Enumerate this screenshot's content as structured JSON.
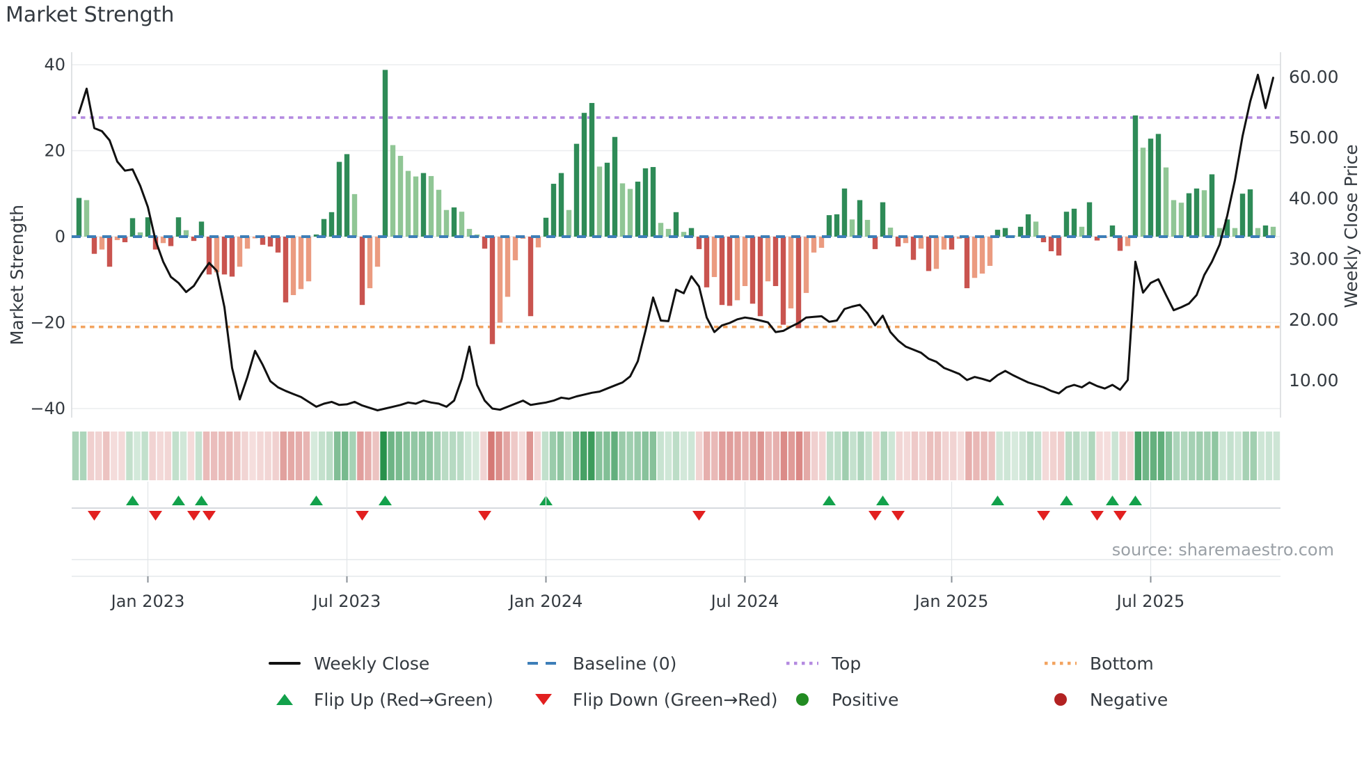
{
  "title": "Market Strength",
  "source": "source: sharemaestro.com",
  "chart_data": {
    "type": "combo-bar-line-heatmap",
    "title": "Market Strength",
    "left_axis": {
      "label": "Market Strength",
      "ticks": [
        "40",
        "20",
        "0",
        "−20",
        "−40"
      ],
      "tick_values": [
        40,
        20,
        0,
        -20,
        -40
      ],
      "range": [
        -44,
        44
      ],
      "grid": true
    },
    "right_axis": {
      "label": "Weekly Close Price",
      "ticks": [
        "60.00",
        "50.00",
        "40.00",
        "30.00",
        "20.00",
        "10.00"
      ],
      "tick_values": [
        60,
        50,
        40,
        30,
        20,
        10
      ]
    },
    "x_ticks": [
      {
        "index": 9,
        "label": "Jan 2023"
      },
      {
        "index": 35,
        "label": "Jul 2023"
      },
      {
        "index": 61,
        "label": "Jan 2024"
      },
      {
        "index": 87,
        "label": "Jul 2024"
      },
      {
        "index": 114,
        "label": "Jan 2025"
      },
      {
        "index": 140,
        "label": "Jul 2025"
      }
    ],
    "baseline_value": 0,
    "top_level_value": 27.7,
    "bottom_level_value": -21,
    "series": [
      {
        "name": "Market Strength (weekly bars)",
        "type": "bar",
        "values": [
          9,
          8.5,
          -4,
          -3,
          -7,
          -0.8,
          -1.3,
          4.3,
          1,
          4.5,
          -3,
          -1.5,
          -2.2,
          4.5,
          1.5,
          -1,
          3.5,
          -8.8,
          -8.3,
          -8.8,
          -9.3,
          -7,
          -2.8,
          -0.4,
          -1.9,
          -2.3,
          -3.7,
          -15.3,
          -13.6,
          -12.2,
          -10.4,
          0.5,
          4.1,
          5.7,
          17.4,
          19.2,
          9.9,
          -15.9,
          -12,
          -7,
          38.8,
          21.3,
          18.8,
          15.3,
          14,
          14.8,
          14.1,
          10.9,
          6.2,
          6.8,
          5.8,
          1.8,
          0.5,
          -2.8,
          -25,
          -20,
          -14,
          -5.5,
          -0.5,
          -18.5,
          -2.5,
          4.4,
          12.3,
          14.8,
          6.2,
          21.6,
          28.8,
          31.1,
          16.3,
          17.2,
          23.2,
          12.4,
          11.1,
          12.8,
          15.9,
          16.2,
          3.2,
          1.8,
          5.7,
          1.1,
          2,
          -2.9,
          -11.8,
          -9.4,
          -15.9,
          -16.1,
          -14.8,
          -11.5,
          -15.6,
          -18.5,
          -10.4,
          -11.5,
          -20.5,
          -16.7,
          -21.3,
          -13.1,
          -3.7,
          -2.6,
          5,
          5.2,
          11.2,
          4,
          8.5,
          3.9,
          -2.9,
          8,
          2.1,
          -2.3,
          -1.5,
          -5.4,
          -2.8,
          -8,
          -7.5,
          -3,
          -3,
          -0.5,
          -12,
          -9.6,
          -8.6,
          -6.8,
          1.6,
          2,
          0.3,
          2.3,
          5.2,
          3.5,
          -1.3,
          -3.4,
          -4.4,
          5.8,
          6.5,
          2.3,
          8,
          -0.9,
          -0.3,
          2.6,
          -3.3,
          -2.2,
          28.2,
          20.7,
          22.8,
          23.9,
          16.1,
          8.5,
          7.9,
          10.1,
          11.2,
          10.8,
          14.5,
          2,
          4,
          2,
          10,
          11,
          2,
          2.6,
          2.3
        ]
      },
      {
        "name": "Weekly Close",
        "type": "line",
        "values": [
          54,
          58,
          51.5,
          51,
          49.5,
          46,
          44.5,
          44.7,
          42,
          38.5,
          33,
          29.5,
          27,
          26,
          24.5,
          25.5,
          27.5,
          29.3,
          28,
          22,
          12,
          6.8,
          10.5,
          14.8,
          12.5,
          9.8,
          8.8,
          8.2,
          7.7,
          7.2,
          6.4,
          5.6,
          6.1,
          6.4,
          5.9,
          6,
          6.4,
          5.8,
          5.4,
          5,
          5.3,
          5.6,
          5.9,
          6.3,
          6.1,
          6.6,
          6.3,
          6.1,
          5.6,
          6.6,
          10.2,
          15.5,
          9.2,
          6.6,
          5.3,
          5.1,
          5.6,
          6.1,
          6.6,
          5.9,
          6.1,
          6.3,
          6.6,
          7.1,
          6.9,
          7.3,
          7.6,
          7.9,
          8.1,
          8.6,
          9.1,
          9.6,
          10.6,
          13.1,
          18.1,
          23.6,
          19.8,
          19.7,
          24.9,
          24.3,
          27.1,
          25.4,
          20.3,
          17.9,
          19,
          19.4,
          20,
          20.3,
          20.1,
          19.8,
          19.5,
          17.9,
          18.1,
          18.8,
          19.4,
          20.3,
          20.4,
          20.5,
          19.6,
          19.8,
          21.7,
          22.1,
          22.4,
          21,
          19,
          20.6,
          17.9,
          16.5,
          15.5,
          15,
          14.5,
          13.5,
          13,
          12,
          11.5,
          11,
          10,
          10.5,
          10.2,
          9.8,
          10.8,
          11.5,
          10.8,
          10.2,
          9.6,
          9.2,
          8.8,
          8.2,
          7.8,
          8.8,
          9.2,
          8.8,
          9.6,
          9,
          8.6,
          9.2,
          8.4,
          10,
          29.5,
          24.4,
          26,
          26.6,
          24,
          21.5,
          22,
          22.6,
          24,
          27.3,
          29.5,
          32.3,
          37.1,
          42.9,
          50.2,
          55.9,
          60.3,
          54.8,
          59.8
        ]
      }
    ],
    "heatmap": {
      "note": "pastel strip below chart, one cell per week, color derived from bar sign and magnitude"
    },
    "flip_up_weeks": [
      7,
      13,
      16,
      31,
      40,
      61,
      98,
      105,
      120,
      129,
      135,
      138
    ],
    "flip_down_weeks": [
      2,
      10,
      15,
      17,
      37,
      53,
      81,
      104,
      107,
      126,
      133,
      136
    ],
    "colors": {
      "bar_positive_dark": "#2e8b57",
      "bar_positive_light": "#90c695",
      "bar_negative_dark": "#c9544f",
      "bar_negative_light": "#eb9b80",
      "baseline": "#3d7eb8",
      "top_line": "#b48ae0",
      "bottom_line": "#f2a35f",
      "close_line": "#111111",
      "flip_up": "#12a14b",
      "flip_down": "#e22020",
      "positive_dot": "#228b22",
      "negative_dot": "#b22222",
      "grid": "#ebedef",
      "panel_line": "#c9ced4",
      "text": "#343a40",
      "muted_text": "#9aa0a6"
    },
    "legend_position": "bottom"
  },
  "legend": {
    "rows": [
      [
        {
          "swatch": "line-black",
          "label": "Weekly Close"
        },
        {
          "swatch": "dash-blue",
          "label": "Baseline (0)"
        },
        {
          "swatch": "dots-purple",
          "label": "Top"
        },
        {
          "swatch": "dots-orange",
          "label": "Bottom"
        }
      ],
      [
        {
          "swatch": "triangle-up-green",
          "label": "Flip Up (Red→Green)"
        },
        {
          "swatch": "triangle-down-red",
          "label": "Flip Down (Green→Red)"
        },
        {
          "swatch": "dot-green",
          "label": "Positive"
        },
        {
          "swatch": "dot-darkred",
          "label": "Negative"
        }
      ]
    ]
  }
}
